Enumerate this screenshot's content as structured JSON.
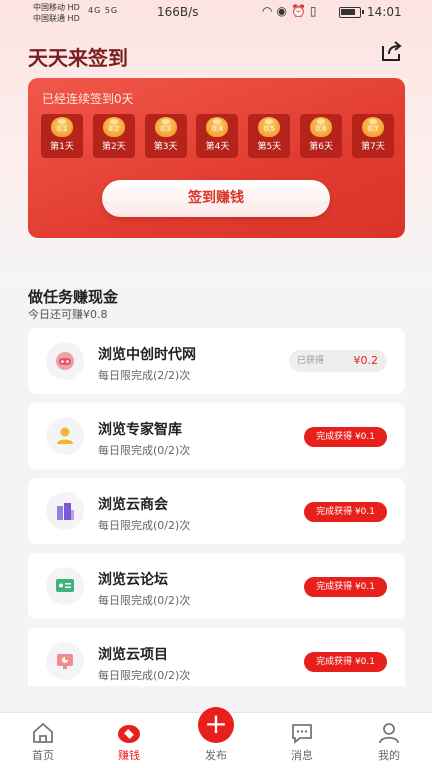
{
  "status_bar": {
    "carrier1": "中国移动",
    "carrier2": "中国联通",
    "hd_badge": "HD",
    "signal": "4G 5G",
    "net_speed": "166B/s",
    "time": "14:01"
  },
  "header": {
    "title": "天天来签到",
    "share_icon": "share-icon"
  },
  "sign_card": {
    "streak_text": "已经连续签到0天",
    "days": [
      {
        "coin": "0.1",
        "label": "第1天"
      },
      {
        "coin": "0.2",
        "label": "第2天"
      },
      {
        "coin": "0.3",
        "label": "第3天"
      },
      {
        "coin": "0.4",
        "label": "第4天"
      },
      {
        "coin": "0.5",
        "label": "第5天"
      },
      {
        "coin": "0.6",
        "label": "第6天"
      },
      {
        "coin": "0.7",
        "label": "第7天"
      }
    ],
    "button_label": "签到赚钱",
    "accent_color": "#e23c30"
  },
  "tasks": {
    "title": "做任务赚现金",
    "subtitle": "今日还可赚¥0.8",
    "items": [
      {
        "name": "浏览中创时代网",
        "desc": "每日限完成(2/2)次",
        "earned_label": "已获得",
        "earned_amount": "¥0.2",
        "icon": "robot-icon"
      },
      {
        "name": "浏览专家智库",
        "desc": "每日限完成(0/2)次",
        "reward": "完成获得 ¥0.1",
        "icon": "expert-icon"
      },
      {
        "name": "浏览云商会",
        "desc": "每日限完成(0/2)次",
        "reward": "完成获得 ¥0.1",
        "icon": "building-icon"
      },
      {
        "name": "浏览云论坛",
        "desc": "每日限完成(0/2)次",
        "reward": "完成获得 ¥0.1",
        "icon": "forum-icon"
      },
      {
        "name": "浏览云项目",
        "desc": "每日限完成(0/2)次",
        "reward": "完成获得 ¥0.1",
        "icon": "project-icon"
      }
    ]
  },
  "tabbar": {
    "items": [
      {
        "label": "首页",
        "icon": "home-icon"
      },
      {
        "label": "赚钱",
        "icon": "earn-icon",
        "active": true
      },
      {
        "label": "发布",
        "icon": "plus-icon"
      },
      {
        "label": "消息",
        "icon": "message-icon"
      },
      {
        "label": "我的",
        "icon": "profile-icon"
      }
    ]
  }
}
